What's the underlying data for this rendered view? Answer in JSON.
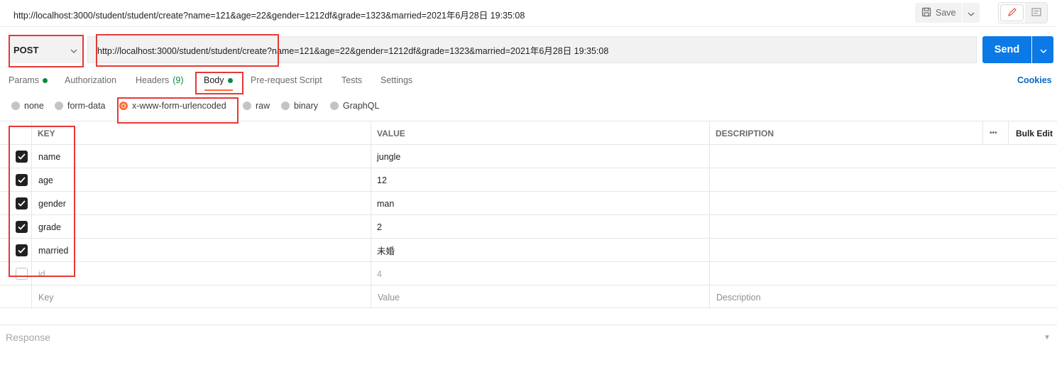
{
  "request": {
    "title": "http://localhost:3000/student/student/create?name=121&age=22&gender=1212df&grade=1323&married=2021年6月28日 19:35:08",
    "method": "POST",
    "url": "http://localhost:3000/student/student/create?name=121&age=22&gender=1212df&grade=1323&married=2021年6月28日 19:35:08"
  },
  "toolbar": {
    "save_label": "Save",
    "send_label": "Send"
  },
  "tabs": [
    {
      "label": "Params",
      "dot": true
    },
    {
      "label": "Authorization"
    },
    {
      "label": "Headers",
      "count": "(9)"
    },
    {
      "label": "Body",
      "dot": true,
      "active": true
    },
    {
      "label": "Pre-request Script"
    },
    {
      "label": "Tests"
    },
    {
      "label": "Settings"
    }
  ],
  "cookies_label": "Cookies",
  "body_types": [
    {
      "label": "none"
    },
    {
      "label": "form-data"
    },
    {
      "label": "x-www-form-urlencoded",
      "selected": true
    },
    {
      "label": "raw"
    },
    {
      "label": "binary"
    },
    {
      "label": "GraphQL"
    }
  ],
  "table": {
    "headers": {
      "key": "KEY",
      "value": "VALUE",
      "description": "DESCRIPTION",
      "more": "•••",
      "bulk_edit": "Bulk Edit"
    },
    "rows": [
      {
        "key": "name",
        "value": "jungle",
        "checked": true
      },
      {
        "key": "age",
        "value": "12",
        "checked": true
      },
      {
        "key": "gender",
        "value": "man",
        "checked": true
      },
      {
        "key": "grade",
        "value": "2",
        "checked": true
      },
      {
        "key": "married",
        "value": "未婚",
        "checked": true
      },
      {
        "key": "id",
        "value": "4",
        "checked": false
      }
    ],
    "placeholder": {
      "key": "Key",
      "value": "Value",
      "description": "Description"
    }
  },
  "response_label": "Response",
  "colors": {
    "accent": "#ff6c37",
    "send": "#0b79e6",
    "status_dot": "#0a8a3e",
    "annotation": "#e53935"
  }
}
